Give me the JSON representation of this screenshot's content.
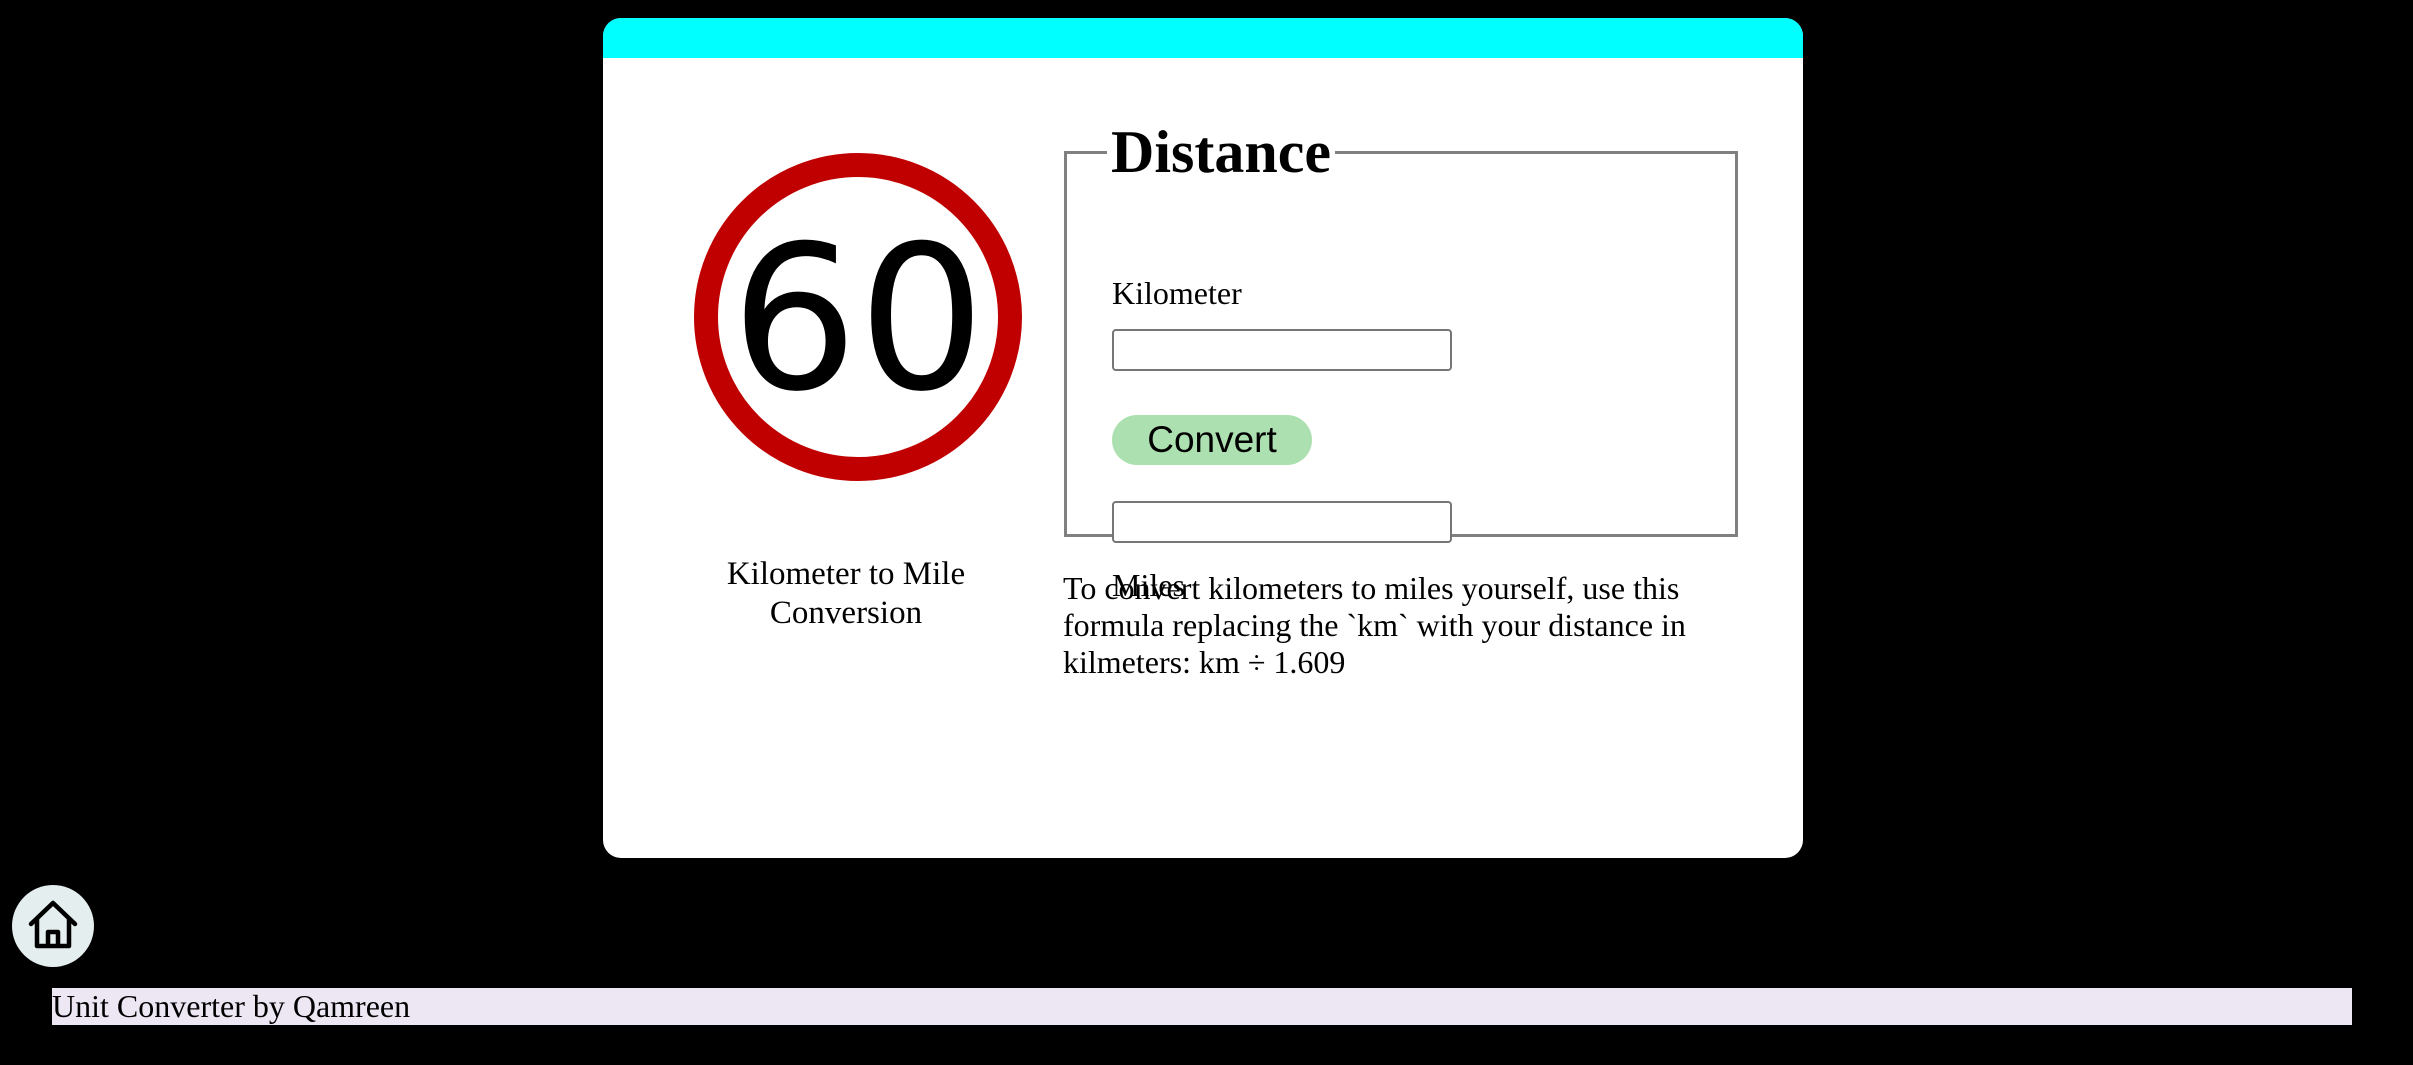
{
  "card": {
    "sign_number": "60",
    "conversion_title": "Kilometer to Mile Conversion",
    "formula_text": "To convert kilometers to miles yourself, use this formula replacing the `km` with your distance in kilmeters: km ÷ 1.609"
  },
  "form": {
    "legend": "Distance",
    "kilometer_label": "Kilometer",
    "kilometer_value": "",
    "convert_label": "Convert",
    "miles_value": "",
    "miles_label": "Miles"
  },
  "footer": {
    "text": "Unit Converter by Qamreen"
  },
  "icons": {
    "home": "home-icon"
  },
  "colors": {
    "page_background": "#000000",
    "card_background": "#ffffff",
    "card_accent": "#00ffff",
    "sign_ring": "#c00000",
    "convert_button": "#ade0b0",
    "footer_background": "#ede7f3",
    "home_button_background": "#e4eeee"
  }
}
